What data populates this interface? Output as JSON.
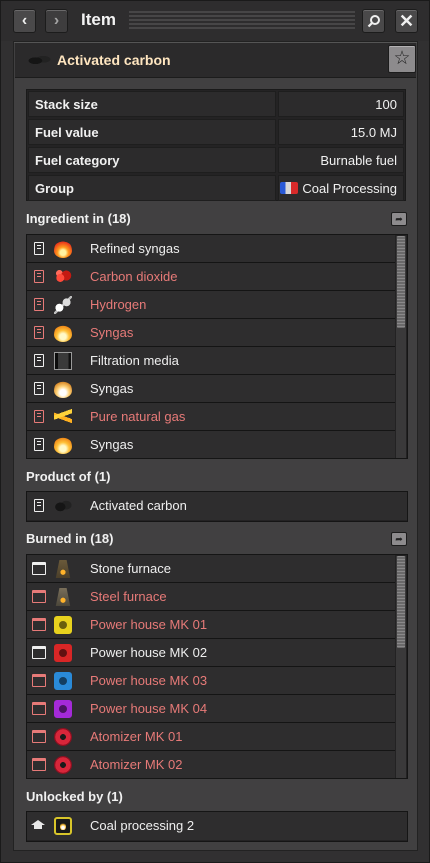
{
  "window": {
    "title": "Item",
    "back_icon": "chevron-left-icon",
    "forward_icon": "chevron-right-icon",
    "search_icon": "search-icon",
    "close_icon": "close-icon"
  },
  "item": {
    "name": "Activated carbon",
    "favorite_icon": "star-icon"
  },
  "info": [
    {
      "key": "Stack size",
      "value": "100"
    },
    {
      "key": "Fuel value",
      "value": "15.0 MJ"
    },
    {
      "key": "Fuel category",
      "value": "Burnable fuel"
    },
    {
      "key": "Group",
      "value": "Coal Processing"
    }
  ],
  "ingredient_in": {
    "title": "Ingredient in (18)",
    "items": [
      {
        "label": "Refined syngas",
        "color": "white",
        "icon": "fire-icon"
      },
      {
        "label": "Carbon dioxide",
        "color": "red",
        "icon": "carbon-dioxide-icon"
      },
      {
        "label": "Hydrogen",
        "color": "red",
        "icon": "hydrogen-icon"
      },
      {
        "label": "Syngas",
        "color": "red",
        "icon": "syngas-icon"
      },
      {
        "label": "Filtration media",
        "color": "white",
        "icon": "filtration-media-icon"
      },
      {
        "label": "Syngas",
        "color": "white",
        "icon": "syngas-icon"
      },
      {
        "label": "Pure natural gas",
        "color": "red",
        "icon": "natural-gas-icon"
      },
      {
        "label": "Syngas",
        "color": "white",
        "icon": "syngas-icon"
      }
    ]
  },
  "product_of": {
    "title": "Product of (1)",
    "items": [
      {
        "label": "Activated carbon",
        "color": "white",
        "icon": "activated-carbon-icon"
      }
    ]
  },
  "burned_in": {
    "title": "Burned in (18)",
    "items": [
      {
        "label": "Stone furnace",
        "color": "white",
        "icon": "stone-furnace-icon"
      },
      {
        "label": "Steel furnace",
        "color": "red",
        "icon": "steel-furnace-icon"
      },
      {
        "label": "Power house MK 01",
        "color": "red",
        "icon": "power-house-icon",
        "icon_color": "#e8d21e"
      },
      {
        "label": "Power house MK 02",
        "color": "white",
        "icon": "power-house-icon",
        "icon_color": "#d82626"
      },
      {
        "label": "Power house MK 03",
        "color": "red",
        "icon": "power-house-icon",
        "icon_color": "#2a8ad8"
      },
      {
        "label": "Power house MK 04",
        "color": "red",
        "icon": "power-house-icon",
        "icon_color": "#a42ad8"
      },
      {
        "label": "Atomizer MK 01",
        "color": "red",
        "icon": "atomizer-icon"
      },
      {
        "label": "Atomizer MK 02",
        "color": "red",
        "icon": "atomizer-icon"
      }
    ]
  },
  "unlocked_by": {
    "title": "Unlocked by (1)",
    "items": [
      {
        "label": "Coal processing 2",
        "color": "white",
        "icon": "coal-processing-tech-icon"
      }
    ]
  },
  "colors": {
    "white_text": "#efefef",
    "red_text": "#e77a78",
    "title_text": "#ffe6c0"
  }
}
